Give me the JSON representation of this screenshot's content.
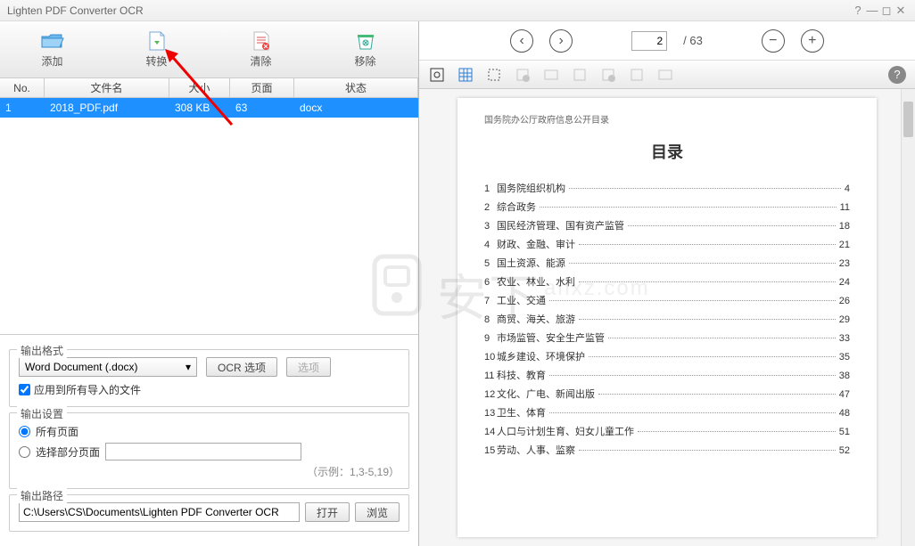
{
  "window": {
    "title": "Lighten PDF Converter OCR"
  },
  "toolbar": {
    "add": "添加",
    "convert": "转换",
    "clear": "清除",
    "remove": "移除"
  },
  "columns": {
    "no": "No.",
    "name": "文件名",
    "size": "大小",
    "pages": "页面",
    "status": "状态"
  },
  "rows": [
    {
      "no": "1",
      "name": "2018_PDF.pdf",
      "size": "308 KB",
      "pages": "63",
      "status": "docx"
    }
  ],
  "format": {
    "legend": "输出格式",
    "selected": "Word Document (.docx)",
    "ocr_btn": "OCR 选项",
    "opts_btn": "选项",
    "apply_all": "应用到所有导入的文件"
  },
  "settings": {
    "legend": "输出设置",
    "all_pages": "所有页面",
    "select_pages": "选择部分页面",
    "hint": "（示例：1,3-5,19）"
  },
  "path": {
    "legend": "输出路径",
    "value": "C:\\Users\\CS\\Documents\\Lighten PDF Converter OCR",
    "open": "打开",
    "browse": "浏览"
  },
  "nav": {
    "current": "2",
    "total": "/ 63"
  },
  "doc": {
    "header": "国务院办公厅政府信息公开目录",
    "title": "目录",
    "toc": [
      {
        "n": "1",
        "t": "国务院组织机构",
        "p": "4"
      },
      {
        "n": "2",
        "t": "综合政务",
        "p": "11"
      },
      {
        "n": "3",
        "t": "国民经济管理、国有资产监管",
        "p": "18"
      },
      {
        "n": "4",
        "t": "财政、金融、审计",
        "p": "21"
      },
      {
        "n": "5",
        "t": "国土资源、能源",
        "p": "23"
      },
      {
        "n": "6",
        "t": "农业、林业、水利",
        "p": "24"
      },
      {
        "n": "7",
        "t": "工业、交通",
        "p": "26"
      },
      {
        "n": "8",
        "t": "商贸、海关、旅游",
        "p": "29"
      },
      {
        "n": "9",
        "t": "市场监管、安全生产监管",
        "p": "33"
      },
      {
        "n": "10",
        "t": "城乡建设、环境保护",
        "p": "35"
      },
      {
        "n": "11",
        "t": "科技、教育",
        "p": "38"
      },
      {
        "n": "12",
        "t": "文化、广电、新闻出版",
        "p": "47"
      },
      {
        "n": "13",
        "t": "卫生、体育",
        "p": "48"
      },
      {
        "n": "14",
        "t": "人口与计划生育、妇女儿童工作",
        "p": "51"
      },
      {
        "n": "15",
        "t": "劳动、人事、监察",
        "p": "52"
      }
    ]
  },
  "watermark": "安下"
}
